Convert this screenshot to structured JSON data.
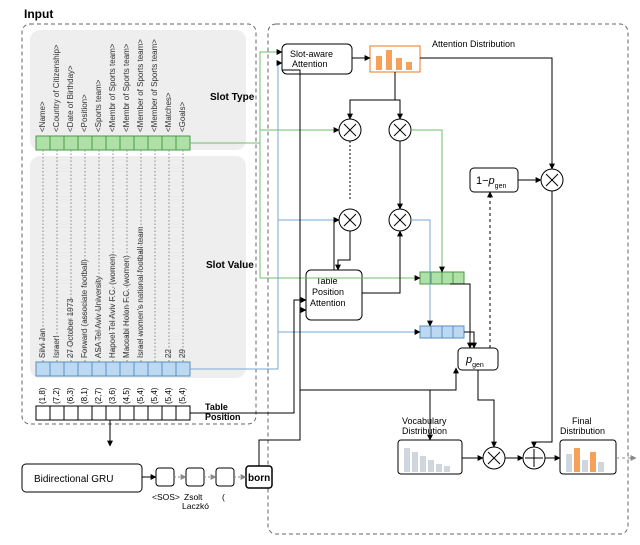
{
  "panel": {
    "input_title": "Input"
  },
  "labels": {
    "slot_type": "Slot Type",
    "slot_value": "Slot Value",
    "table_position": "Table\nPosition",
    "slot_aware_attention": "Slot-aware\nAttention",
    "attention_distribution": "Attention Distribution",
    "table_position_attention": "Table\nPosition\nAttention",
    "one_minus_pgen": "1−p",
    "pgen_sub": "gen",
    "pgen": "p",
    "vocab_distribution": "Vocabulary\nDistribution",
    "final_distribution": "Final\nDistribution",
    "gru": "Bidirectional GRU"
  },
  "slot_types": [
    "<Name>",
    "<Country of Citizenship>",
    "<Date of Birthday>",
    "<Position>",
    "<Sports team>",
    "<Membr of Sports team>",
    "<Membr of Sports team>",
    "<Member of Sports team>",
    "<Member of Sports team>",
    "<Matches>",
    "<Goals>"
  ],
  "slot_values": [
    "Silvi Jan",
    "Israerl",
    "27 October 1973",
    "Forward (associate football)",
    "ASA Tel Aviv University",
    "Hapoel Tel Aviv F.C. (women)",
    "Maccabi Holon F.C. (women)",
    "Israel women's national football team",
    "",
    "22",
    "29"
  ],
  "table_positions": [
    "(1,8)",
    "(7,2)",
    "(6,3)",
    "(8,1)",
    "(2,7)",
    "(3,6)",
    "(4,5)",
    "(5,4)",
    "(5,4)",
    "(5,4)",
    "(5,4)"
  ],
  "decoder_tokens": {
    "sos": "<SOS>",
    "t1": "Zsolt\nLaczkó",
    "t2": "(",
    "t3": "born"
  }
}
